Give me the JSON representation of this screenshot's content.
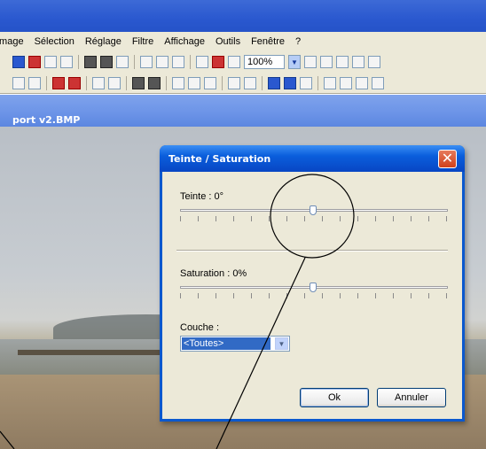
{
  "menubar": {
    "items": [
      "Image",
      "Sélection",
      "Réglage",
      "Filtre",
      "Affichage",
      "Outils",
      "Fenêtre",
      "?"
    ]
  },
  "toolbar": {
    "zoom_value": "100%"
  },
  "document": {
    "title": "port v2.BMP"
  },
  "dialog": {
    "title": "Teinte / Saturation",
    "hue_label": "Teinte : 0°",
    "hue_value": 0,
    "saturation_label": "Saturation : 0%",
    "saturation_value": 0,
    "channel_label": "Couche :",
    "channel_selected": "<Toutes>",
    "ok_label": "Ok",
    "cancel_label": "Annuler"
  },
  "colors": {
    "title_blue": "#0a5edc",
    "close_red": "#d1401a",
    "selection_blue": "#316ac5",
    "dialog_face": "#ece9d8"
  },
  "icons": [
    "undo-icon",
    "redo-icon",
    "zoom-in-icon",
    "zoom-out-icon",
    "close-icon",
    "chevron-down-icon"
  ]
}
